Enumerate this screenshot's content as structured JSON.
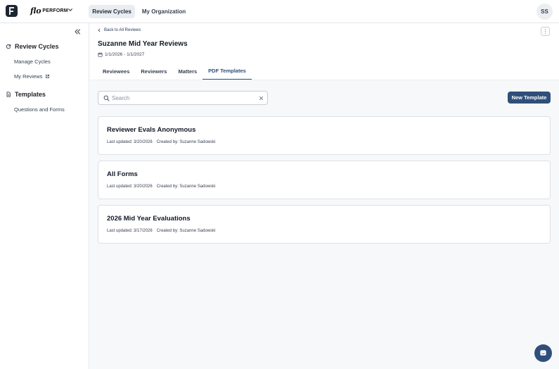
{
  "app": {
    "brand_script": "flo",
    "brand_word": "PERFORM",
    "nav_tabs": [
      "Review Cycles",
      "My Organization"
    ],
    "user_initials": "SS"
  },
  "sidebar": {
    "sections": [
      {
        "label": "Review Cycles",
        "icon": "refresh-icon",
        "items": [
          "Manage Cycles",
          "My Reviews"
        ]
      },
      {
        "label": "Templates",
        "icon": "document-icon",
        "items": [
          "Questions and Forms"
        ]
      }
    ]
  },
  "header": {
    "back_label": "Back to All Reviews",
    "title": "Suzanne Mid Year Reviews",
    "date_range": "1/1/2026 - 1/1/2027",
    "tabs": [
      "Reviewees",
      "Reviewers",
      "Matters",
      "PDF Templates"
    ],
    "active_tab": "PDF Templates"
  },
  "toolbar": {
    "search_placeholder": "Search",
    "search_value": "",
    "new_template_label": "New Template"
  },
  "templates": [
    {
      "name": "Reviewer Evals Anonymous",
      "updated": "Last updated: 3/20/2026",
      "created_by": "Created by: Suzanne Sadowski"
    },
    {
      "name": "All Forms",
      "updated": "Last updated: 3/20/2026",
      "created_by": "Created by: Suzanne Sadowski"
    },
    {
      "name": "2026 Mid Year Evaluations",
      "updated": "Last updated: 3/17/2026",
      "created_by": "Created by: Suzanne Sadowski"
    }
  ],
  "colors": {
    "accent": "#2f4f7a",
    "nav_active_bg": "#e9edf2",
    "content_bg": "#f7f8fa"
  }
}
